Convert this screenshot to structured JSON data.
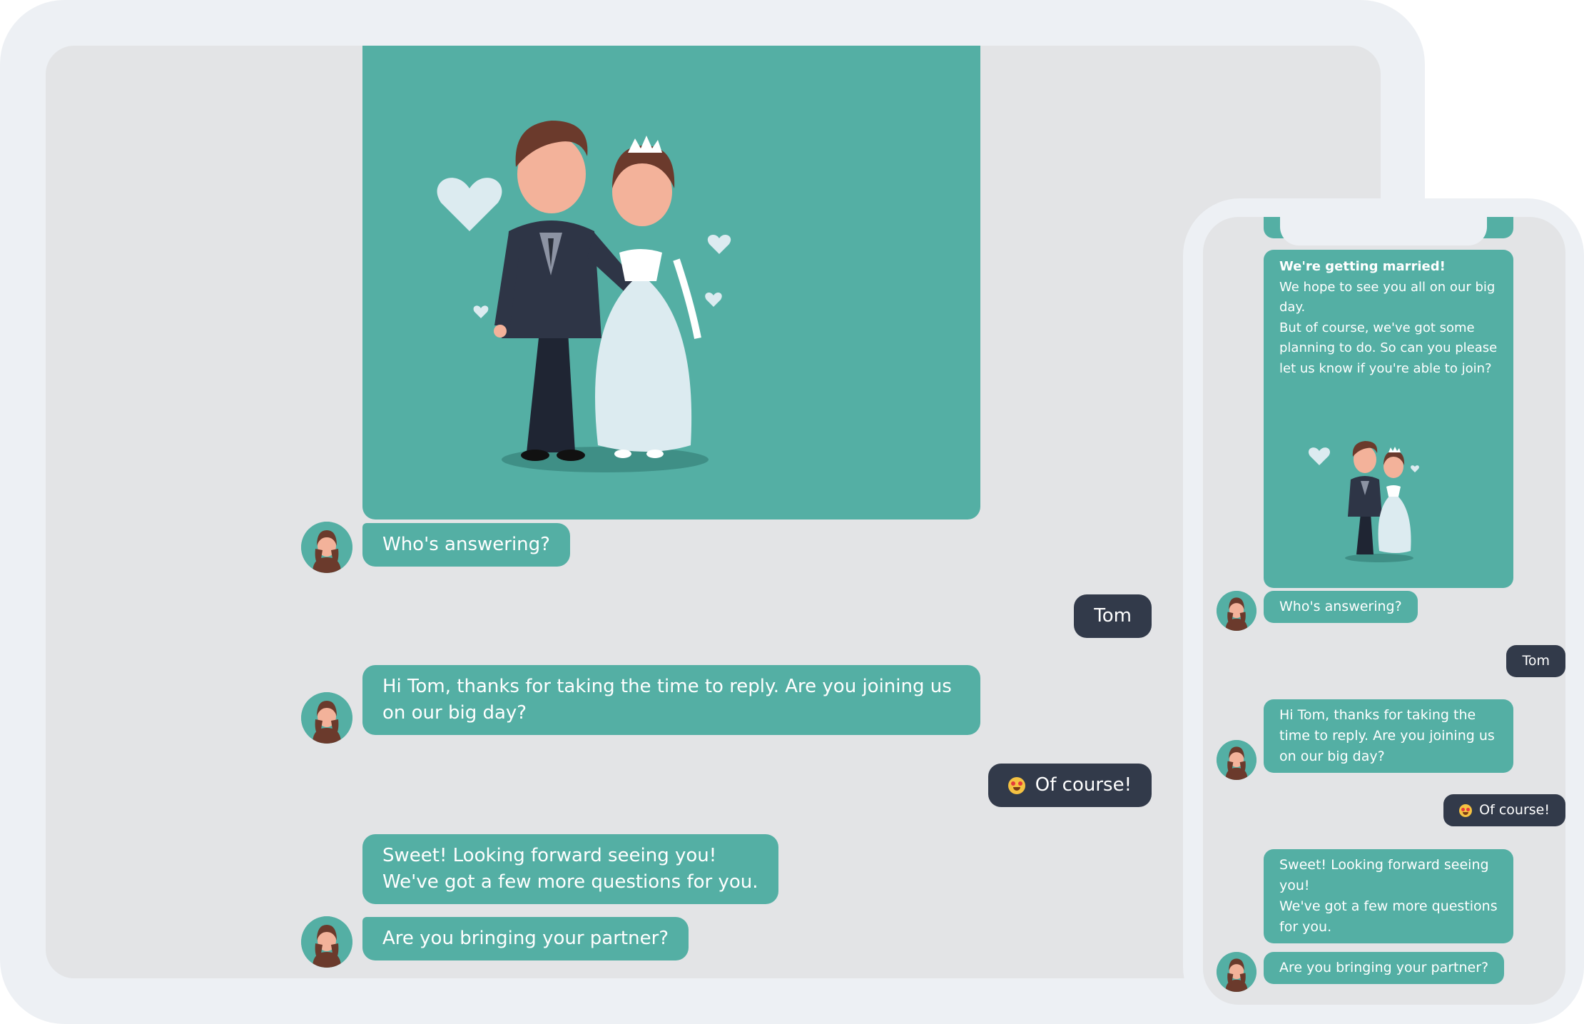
{
  "colors": {
    "bot_bubble": "#54afa4",
    "user_bubble": "#323a4a",
    "screen_bg": "#e3e4e6",
    "device_frame": "#edf0f4"
  },
  "conversation": {
    "q1": "Who's answering?",
    "a1": "Tom",
    "q2": "Hi Tom, thanks for taking the time to reply. Are you joining us on our big day?",
    "a2_emoji": "smiling-face-with-heart-eyes-icon",
    "a2": "Of course!",
    "q3_line1": "Sweet! Looking forward seeing you!",
    "q3_line2": "We've got a few more questions for you.",
    "q4": "Are you bringing your partner?"
  },
  "phone_intro": {
    "title": "We're getting married!",
    "line1": "We hope to see you all on our big day.",
    "line2": "But of course, we've got some planning to do. So can you please let us know if you're able to join?"
  },
  "illustration": "wedding-couple-illustration"
}
